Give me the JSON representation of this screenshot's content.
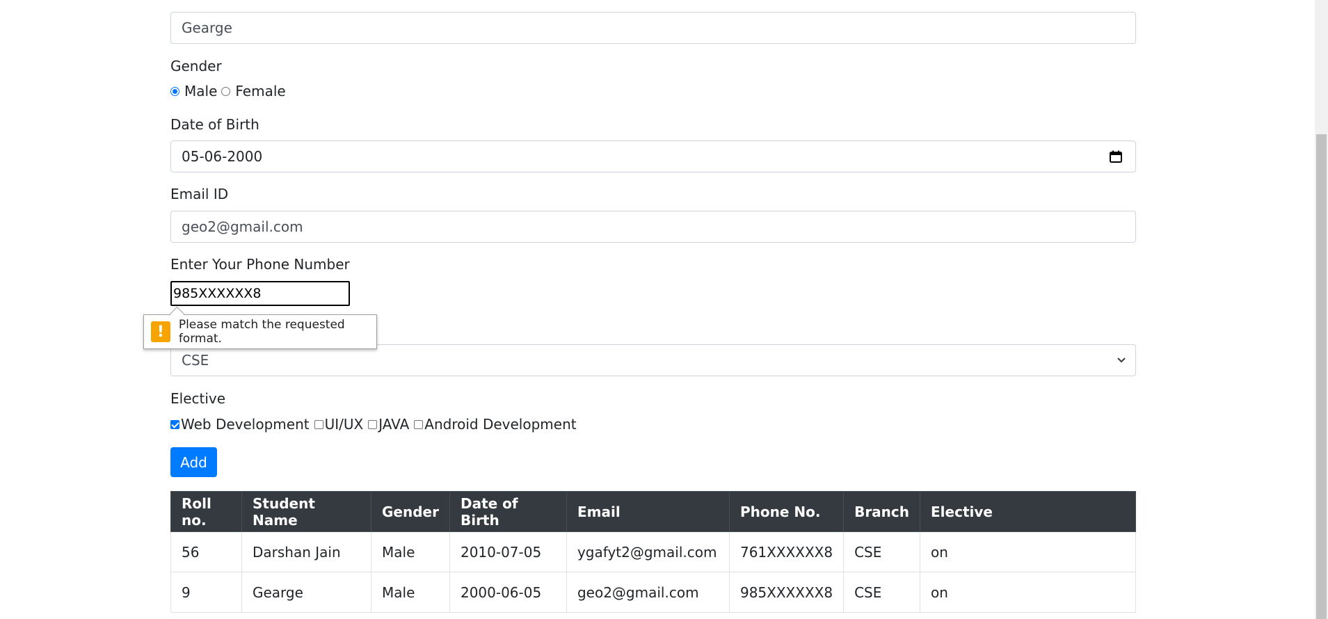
{
  "form": {
    "name_value": "Gearge",
    "gender_label": "Gender",
    "gender_male": "Male",
    "gender_female": "Female",
    "dob_label": "Date of Birth",
    "dob_value": "05-06-2000",
    "email_label": "Email ID",
    "email_value": "geo2@gmail.com",
    "phone_label": "Enter Your Phone Number",
    "phone_value": "985XXXXXX8",
    "branch_value": "CSE",
    "elective_label": "Elective",
    "electives": [
      "Web Development",
      "UI/UX",
      "JAVA",
      "Android Development"
    ],
    "add_button": "Add"
  },
  "tooltip": {
    "icon": "warning-icon",
    "message": "Please match the requested format."
  },
  "table": {
    "headers": [
      "Roll no.",
      "Student Name",
      "Gender",
      "Date of Birth",
      "Email",
      "Phone No.",
      "Branch",
      "Elective"
    ],
    "rows": [
      [
        "56",
        "Darshan Jain",
        "Male",
        "2010-07-05",
        "ygafyt2@gmail.com",
        "761XXXXXX8",
        "CSE",
        "on"
      ],
      [
        "9",
        "Gearge",
        "Male",
        "2000-06-05",
        "geo2@gmail.com",
        "985XXXXXX8",
        "CSE",
        "on"
      ]
    ]
  },
  "colors": {
    "primary": "#007bff",
    "table_header": "#343a40",
    "warning": "#f7a400"
  }
}
